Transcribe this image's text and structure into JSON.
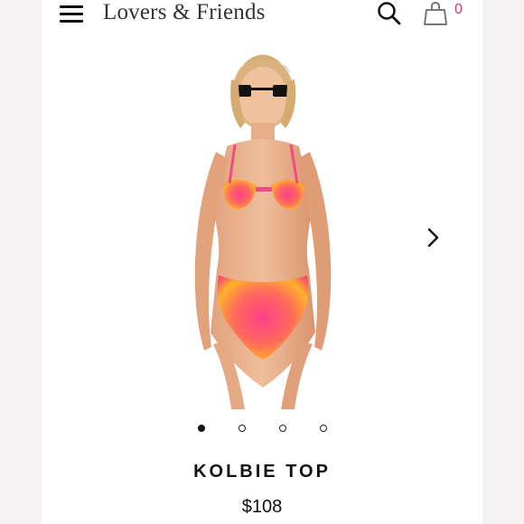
{
  "header": {
    "brand": "Lovers & Friends",
    "menu_icon": "hamburger-menu-icon",
    "search_icon": "search-icon",
    "cart_icon": "shopping-bag-icon",
    "cart_count": "0"
  },
  "product": {
    "name": "KOLBIE TOP",
    "price": "$108",
    "image_alt": "model wearing pink and orange tie-dye bikini",
    "next_icon": "chevron-right-icon"
  },
  "carousel": {
    "total": 4,
    "active_index": 0
  },
  "colors": {
    "accent_pink": "#d43b78",
    "text": "#111111"
  }
}
